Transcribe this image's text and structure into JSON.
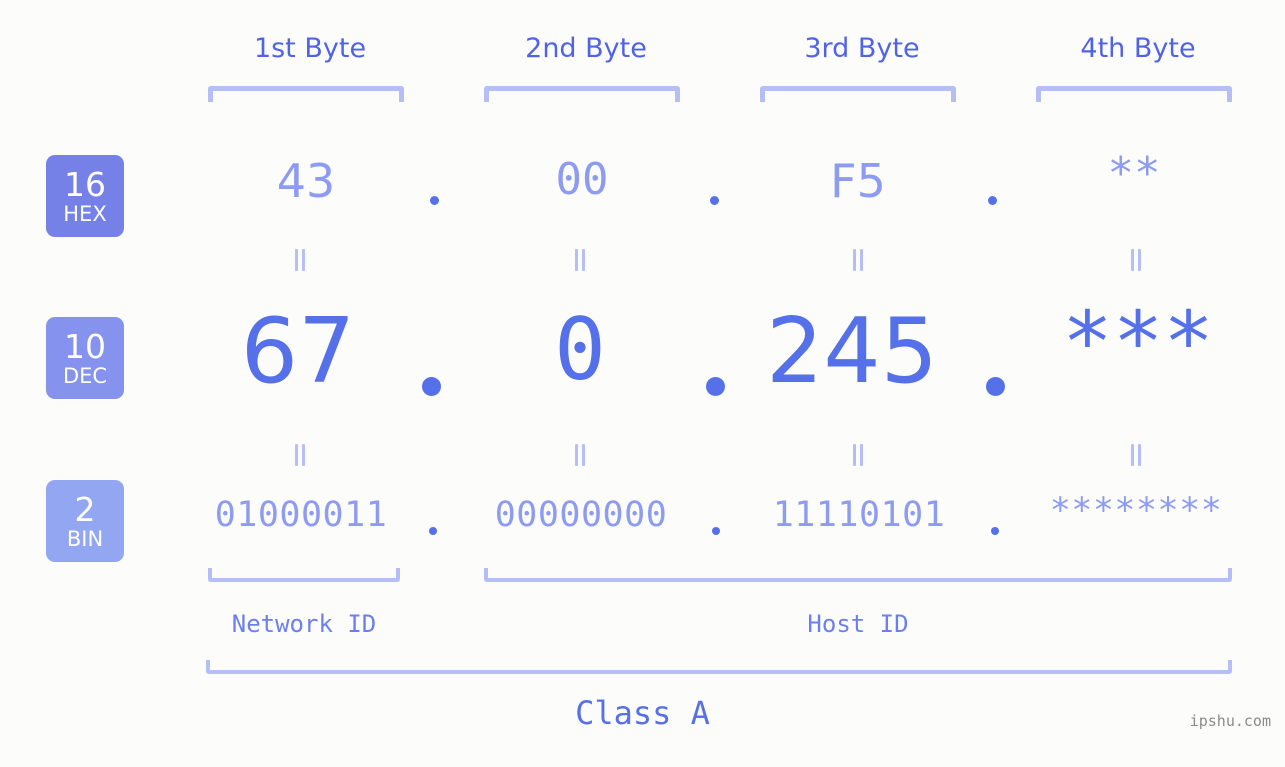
{
  "header": {
    "byte_labels": [
      {
        "label": "1st Byte"
      },
      {
        "label": "2nd Byte"
      },
      {
        "label": "3rd Byte"
      },
      {
        "label": "4th Byte"
      }
    ]
  },
  "bases": [
    {
      "num": "16",
      "name": "HEX",
      "color": "#7681e8"
    },
    {
      "num": "10",
      "name": "DEC",
      "color": "#8592ee"
    },
    {
      "num": "2",
      "name": "BIN",
      "color": "#93a6f2"
    }
  ],
  "rows": {
    "hex": {
      "base_num": "16",
      "base_name": "HEX",
      "values": [
        "43",
        "00",
        "F5",
        "**"
      ]
    },
    "dec": {
      "base_num": "10",
      "base_name": "DEC",
      "values": [
        "67",
        "0",
        "245",
        "***"
      ]
    },
    "bin": {
      "base_num": "2",
      "base_name": "BIN",
      "values": [
        "01000011",
        "00000000",
        "11110101",
        "********"
      ]
    }
  },
  "separators": {
    "glyph": ".",
    "equals": "="
  },
  "footer": {
    "network_id": "Network ID",
    "host_id": "Host ID",
    "class": "Class A",
    "watermark": "ipshu.com"
  },
  "colors": {
    "background": "#fcfdfa",
    "accent_strong": "#5570e8",
    "accent_mid": "#8d9bf2",
    "accent_light": "#b5bef7",
    "header_text": "#4f63e8"
  }
}
